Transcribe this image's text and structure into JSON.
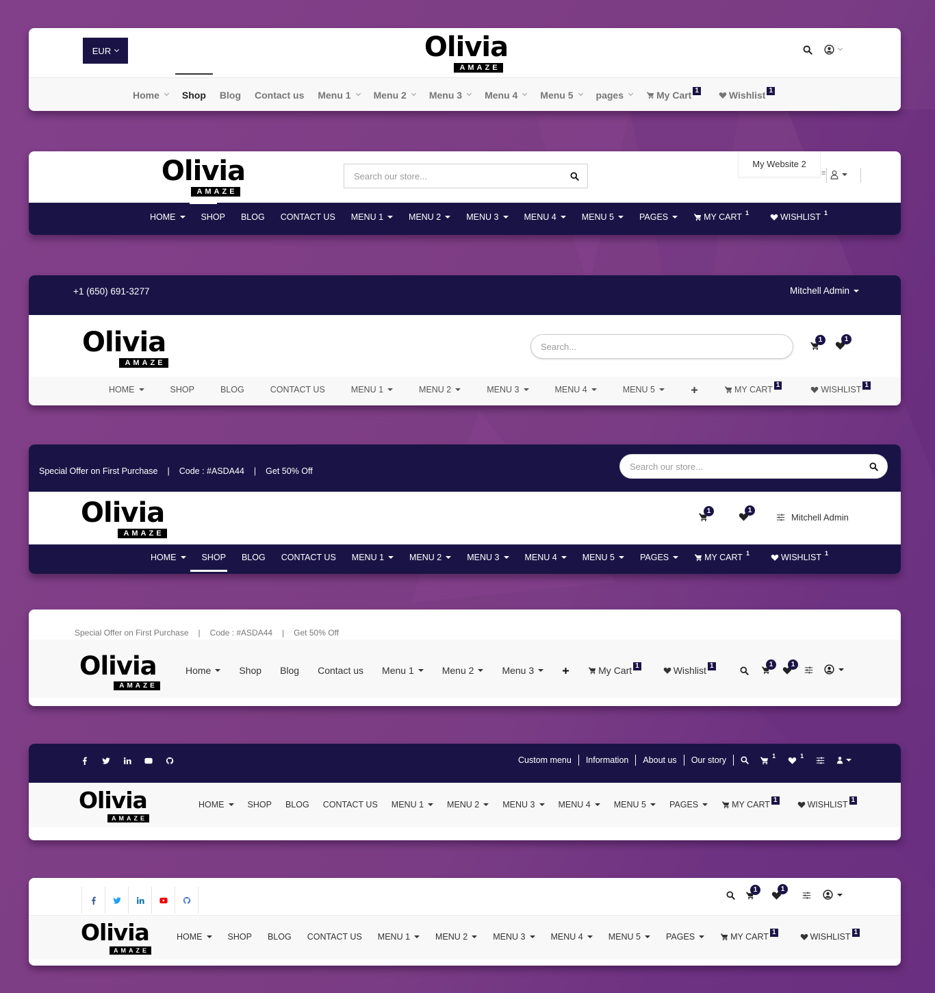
{
  "brand": {
    "name": "Olivia",
    "tagline": "AMAZE"
  },
  "colors": {
    "primary_dark": "#1a1446",
    "background": "#7e3e86",
    "light_bar": "#f8f8f8"
  },
  "header1": {
    "currency": "EUR",
    "nav": [
      {
        "label": "Home",
        "dropdown": true
      },
      {
        "label": "Shop",
        "dropdown": false,
        "active": true
      },
      {
        "label": "Blog",
        "dropdown": false
      },
      {
        "label": "Contact us",
        "dropdown": false
      },
      {
        "label": "Menu 1",
        "dropdown": true
      },
      {
        "label": "Menu 2",
        "dropdown": true
      },
      {
        "label": "Menu 3",
        "dropdown": true
      },
      {
        "label": "Menu 4",
        "dropdown": true
      },
      {
        "label": "Menu 5",
        "dropdown": true
      },
      {
        "label": "pages",
        "dropdown": true
      }
    ],
    "cart_label": "My Cart",
    "cart_count": "1",
    "wishlist_label": "Wishlist",
    "wishlist_count": "1"
  },
  "header2": {
    "search_placeholder": "Search our store...",
    "website_dropdown": "My Website 2",
    "nav": [
      {
        "label": "HOME",
        "dropdown": true
      },
      {
        "label": "SHOP",
        "dropdown": false
      },
      {
        "label": "BLOG",
        "dropdown": false
      },
      {
        "label": "CONTACT US",
        "dropdown": false
      },
      {
        "label": "MENU 1",
        "dropdown": true
      },
      {
        "label": "MENU 2",
        "dropdown": true
      },
      {
        "label": "MENU 3",
        "dropdown": true
      },
      {
        "label": "MENU 4",
        "dropdown": true
      },
      {
        "label": "MENU 5",
        "dropdown": true
      },
      {
        "label": "PAGES",
        "dropdown": true
      }
    ],
    "cart_label": "MY CART",
    "cart_count": "1",
    "wishlist_label": "WISHLIST",
    "wishlist_count": "1"
  },
  "header3": {
    "phone": "+1 (650) 691-3277",
    "user": "Mitchell Admin",
    "search_placeholder": "Search...",
    "cart_count": "1",
    "wishlist_count": "1",
    "nav": [
      {
        "label": "HOME",
        "dropdown": true
      },
      {
        "label": "SHOP",
        "dropdown": false
      },
      {
        "label": "BLOG",
        "dropdown": false
      },
      {
        "label": "CONTACT US",
        "dropdown": false
      },
      {
        "label": "MENU 1",
        "dropdown": true
      },
      {
        "label": "MENU 2",
        "dropdown": true
      },
      {
        "label": "MENU 3",
        "dropdown": true
      },
      {
        "label": "MENU 4",
        "dropdown": true
      },
      {
        "label": "MENU 5",
        "dropdown": true
      }
    ],
    "cart_label": "MY CART",
    "nav_cart_count": "1",
    "wishlist_label": "WISHLIST",
    "nav_wishlist_count": "1"
  },
  "header4": {
    "offer": "Special Offer on First Purchase",
    "code": "Code : #ASDA44",
    "discount": "Get 50% Off",
    "separator": "|",
    "search_placeholder": "Search our store...",
    "cart_count": "1",
    "wishlist_count": "1",
    "user": "Mitchell Admin",
    "nav": [
      {
        "label": "HOME",
        "dropdown": true
      },
      {
        "label": "SHOP",
        "dropdown": false,
        "active": true
      },
      {
        "label": "BLOG",
        "dropdown": false
      },
      {
        "label": "CONTACT US",
        "dropdown": false
      },
      {
        "label": "MENU 1",
        "dropdown": true
      },
      {
        "label": "MENU 2",
        "dropdown": true
      },
      {
        "label": "MENU 3",
        "dropdown": true
      },
      {
        "label": "MENU 4",
        "dropdown": true
      },
      {
        "label": "MENU 5",
        "dropdown": true
      },
      {
        "label": "PAGES",
        "dropdown": true
      }
    ],
    "cart_label": "MY CART",
    "nav_cart_count": "1",
    "wishlist_label": "WISHLIST",
    "nav_wishlist_count": "1"
  },
  "header5": {
    "offer": "Special Offer on First Purchase",
    "code": "Code : #ASDA44",
    "discount": "Get 50% Off",
    "separator": "|",
    "nav": [
      {
        "label": "Home",
        "dropdown": true
      },
      {
        "label": "Shop",
        "dropdown": false
      },
      {
        "label": "Blog",
        "dropdown": false
      },
      {
        "label": "Contact us",
        "dropdown": false
      },
      {
        "label": "Menu 1",
        "dropdown": true
      },
      {
        "label": "Menu 2",
        "dropdown": true
      },
      {
        "label": "Menu 3",
        "dropdown": true
      }
    ],
    "cart_label": "My Cart",
    "nav_cart_count": "1",
    "wishlist_label": "Wishlist",
    "nav_wishlist_count": "1",
    "cart_count": "1",
    "wishlist_count": "1"
  },
  "header6": {
    "social": [
      "facebook",
      "twitter",
      "linkedin",
      "youtube",
      "github"
    ],
    "links": [
      "Custom menu",
      "Information",
      "About us",
      "Our story"
    ],
    "cart_count": "1",
    "wishlist_count": "1",
    "nav": [
      {
        "label": "HOME",
        "dropdown": true
      },
      {
        "label": "SHOP",
        "dropdown": false
      },
      {
        "label": "BLOG",
        "dropdown": false
      },
      {
        "label": "CONTACT US",
        "dropdown": false
      },
      {
        "label": "MENU 1",
        "dropdown": true
      },
      {
        "label": "MENU 2",
        "dropdown": true
      },
      {
        "label": "MENU 3",
        "dropdown": true
      },
      {
        "label": "MENU 4",
        "dropdown": true
      },
      {
        "label": "MENU 5",
        "dropdown": true
      },
      {
        "label": "PAGES",
        "dropdown": true
      }
    ],
    "cart_label": "MY CART",
    "nav_cart_count": "1",
    "wishlist_label": "WISHLIST",
    "nav_wishlist_count": "1"
  },
  "header7": {
    "social": [
      "facebook",
      "twitter",
      "linkedin",
      "youtube",
      "github"
    ],
    "cart_count": "1",
    "wishlist_count": "1",
    "nav": [
      {
        "label": "HOME",
        "dropdown": true
      },
      {
        "label": "SHOP",
        "dropdown": false
      },
      {
        "label": "BLOG",
        "dropdown": false
      },
      {
        "label": "CONTACT US",
        "dropdown": false
      },
      {
        "label": "MENU 1",
        "dropdown": true
      },
      {
        "label": "MENU 2",
        "dropdown": true
      },
      {
        "label": "MENU 3",
        "dropdown": true
      },
      {
        "label": "MENU 4",
        "dropdown": true
      },
      {
        "label": "MENU 5",
        "dropdown": true
      },
      {
        "label": "PAGES",
        "dropdown": true
      }
    ],
    "cart_label": "MY CART",
    "nav_cart_count": "1",
    "wishlist_label": "WISHLIST",
    "nav_wishlist_count": "1"
  }
}
